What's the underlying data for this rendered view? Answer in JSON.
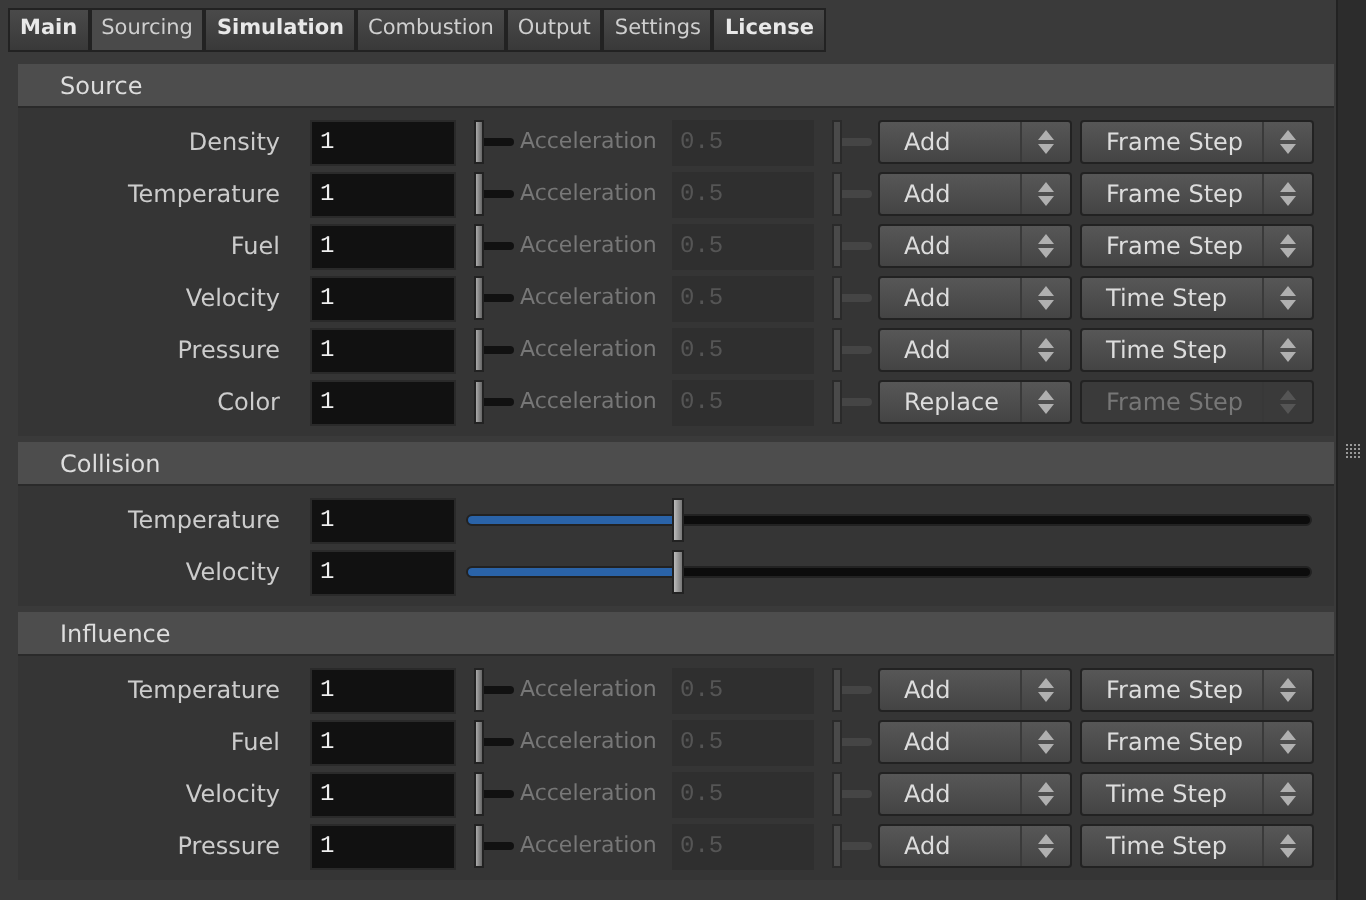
{
  "tabs": [
    {
      "label": "Main",
      "selected": false,
      "modified": true
    },
    {
      "label": "Sourcing",
      "selected": true,
      "modified": false
    },
    {
      "label": "Simulation",
      "selected": false,
      "modified": true
    },
    {
      "label": "Combustion",
      "selected": false,
      "modified": false
    },
    {
      "label": "Output",
      "selected": false,
      "modified": false
    },
    {
      "label": "Settings",
      "selected": false,
      "modified": false
    },
    {
      "label": "License",
      "selected": false,
      "modified": true
    }
  ],
  "sections": [
    {
      "title": "Source",
      "kind": "mixing",
      "rows": [
        {
          "label": "Density",
          "value": "1",
          "accel_label": "Acceleration",
          "accel_value": "0.5",
          "accel_disabled": true,
          "operation": "Add",
          "step": "Frame Step",
          "step_disabled": false
        },
        {
          "label": "Temperature",
          "value": "1",
          "accel_label": "Acceleration",
          "accel_value": "0.5",
          "accel_disabled": true,
          "operation": "Add",
          "step": "Frame Step",
          "step_disabled": false
        },
        {
          "label": "Fuel",
          "value": "1",
          "accel_label": "Acceleration",
          "accel_value": "0.5",
          "accel_disabled": true,
          "operation": "Add",
          "step": "Frame Step",
          "step_disabled": false
        },
        {
          "label": "Velocity",
          "value": "1",
          "accel_label": "Acceleration",
          "accel_value": "0.5",
          "accel_disabled": true,
          "operation": "Add",
          "step": "Time Step",
          "step_disabled": false
        },
        {
          "label": "Pressure",
          "value": "1",
          "accel_label": "Acceleration",
          "accel_value": "0.5",
          "accel_disabled": true,
          "operation": "Add",
          "step": "Time Step",
          "step_disabled": false
        },
        {
          "label": "Color",
          "value": "1",
          "accel_label": "Acceleration",
          "accel_value": "0.5",
          "accel_disabled": true,
          "operation": "Replace",
          "step": "Frame Step",
          "step_disabled": true
        }
      ]
    },
    {
      "title": "Collision",
      "kind": "slider",
      "rows": [
        {
          "label": "Temperature",
          "value": "1",
          "level": 0.25
        },
        {
          "label": "Velocity",
          "value": "1",
          "level": 0.25
        }
      ]
    },
    {
      "title": "Influence",
      "kind": "mixing",
      "rows": [
        {
          "label": "Temperature",
          "value": "1",
          "accel_label": "Acceleration",
          "accel_value": "0.5",
          "accel_disabled": true,
          "operation": "Add",
          "step": "Frame Step",
          "step_disabled": false
        },
        {
          "label": "Fuel",
          "value": "1",
          "accel_label": "Acceleration",
          "accel_value": "0.5",
          "accel_disabled": true,
          "operation": "Add",
          "step": "Frame Step",
          "step_disabled": false
        },
        {
          "label": "Velocity",
          "value": "1",
          "accel_label": "Acceleration",
          "accel_value": "0.5",
          "accel_disabled": true,
          "operation": "Add",
          "step": "Time Step",
          "step_disabled": false
        },
        {
          "label": "Pressure",
          "value": "1",
          "accel_label": "Acceleration",
          "accel_value": "0.5",
          "accel_disabled": true,
          "operation": "Add",
          "step": "Time Step",
          "step_disabled": false
        }
      ]
    }
  ]
}
